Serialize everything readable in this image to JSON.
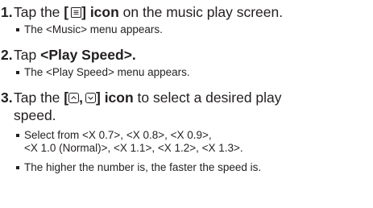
{
  "steps": [
    {
      "number": "1.",
      "pre": "Tap the",
      "icon_open": "[",
      "icon_close": "]",
      "icon": "menu-icon",
      "bold_suffix": "icon",
      "post": "on the music play screen.",
      "bullets": [
        "The <Music> menu appears."
      ]
    },
    {
      "number": "2.",
      "pre": "Tap",
      "bold": "<Play Speed>",
      "post": ".",
      "bullets": [
        "The <Play Speed> menu appears."
      ]
    },
    {
      "number": "3.",
      "pre": "Tap the",
      "icon_open": "[",
      "icon_sep": ",",
      "icon_close": "]",
      "icons": [
        "up-arrow-icon",
        "down-arrow-icon"
      ],
      "bold_suffix": "icon",
      "post": "to select a desired play",
      "post_line2": "speed.",
      "bullets": [
        "Select from <X 0.7>, <X 0.8>, <X 0.9>,",
        "<X 1.0 (Normal)>, <X 1.1>, <X 1.2>, <X 1.3>.",
        "The higher the number is, the faster the speed is."
      ]
    }
  ]
}
